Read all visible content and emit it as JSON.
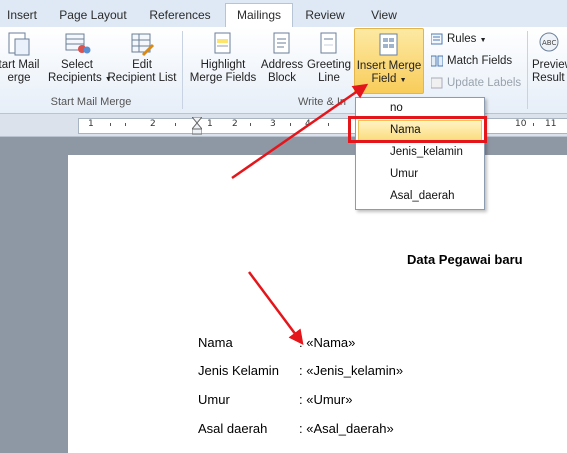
{
  "tabs": [
    {
      "label": "Insert"
    },
    {
      "label": "Page Layout"
    },
    {
      "label": "References"
    },
    {
      "label": "Mailings"
    },
    {
      "label": "Review"
    },
    {
      "label": "View"
    }
  ],
  "ribbon": {
    "start_mail_merge": {
      "group_label": "Start Mail Merge",
      "start_mail_merge_l1": "tart Mail",
      "start_mail_merge_l2": "erge",
      "select_recipients_l1": "Select",
      "select_recipients_l2": "Recipients",
      "edit_list_l1": "Edit",
      "edit_list_l2": "Recipient List"
    },
    "write_insert": {
      "group_label": "Write & In",
      "highlight_l1": "Highlight",
      "highlight_l2": "Merge Fields",
      "address_l1": "Address",
      "address_l2": "Block",
      "greeting_l1": "Greeting",
      "greeting_l2": "Line",
      "insert_merge_l1": "Insert Merge",
      "insert_merge_l2": "Field",
      "rules": "Rules",
      "match_fields": "Match Fields",
      "update_labels": "Update Labels"
    },
    "preview": {
      "l1": "Preview",
      "l2": "Result"
    }
  },
  "ruler": {
    "numbers": [
      "1",
      "2",
      "1",
      "2",
      "3",
      "4",
      "10",
      "11"
    ]
  },
  "dropdown": {
    "items": [
      "no",
      "Nama",
      "Jenis_kelamin",
      "Umur",
      "Asal_daerah"
    ]
  },
  "document": {
    "title": "Data Pegawai baru",
    "rows": [
      {
        "label": "Nama",
        "value": ": «Nama»"
      },
      {
        "label": "Jenis Kelamin",
        "value": ": «Jenis_kelamin»"
      },
      {
        "label": "Umur",
        "value": ": «Umur»"
      },
      {
        "label": "Asal daerah",
        "value": ": «Asal_daerah»"
      }
    ]
  },
  "colors": {
    "annotation_red": "#e4161b",
    "highlight_gold": "#f8cc5a",
    "ribbon_blue": "#dfe9f5"
  }
}
